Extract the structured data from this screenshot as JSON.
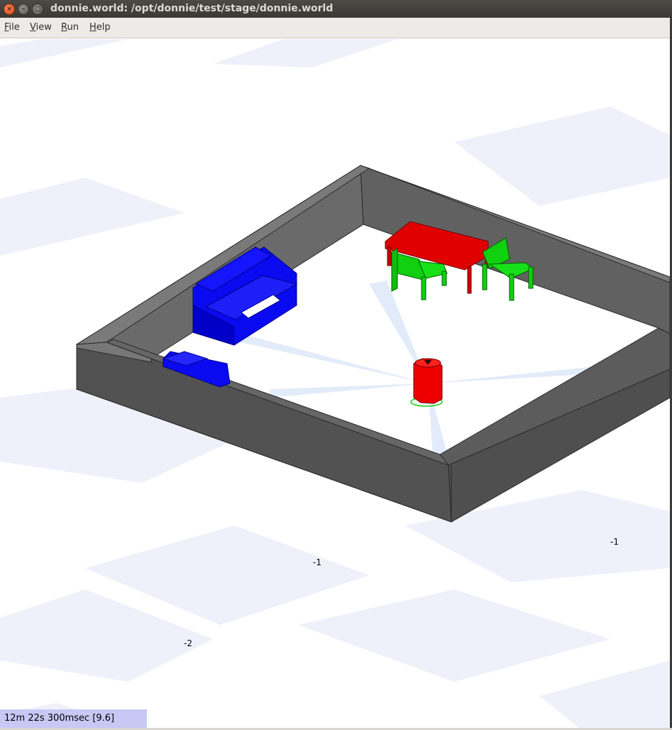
{
  "window": {
    "title": "donnie.world: /opt/donnie/test/stage/donnie.world",
    "close_icon": "×",
    "minimize_icon": "–",
    "maximize_icon": "□"
  },
  "menu": {
    "items": [
      {
        "mnemonic": "F",
        "rest": "ile"
      },
      {
        "mnemonic": "V",
        "rest": "iew"
      },
      {
        "mnemonic": "R",
        "rest": "un"
      },
      {
        "mnemonic": "H",
        "rest": "elp"
      }
    ]
  },
  "world": {
    "axis_labels": [
      "-1",
      "-1",
      "-2"
    ],
    "models": {
      "walls": {
        "color": "#4f4f4f"
      },
      "table": {
        "color": "#e00000"
      },
      "chairs": {
        "color": "#10d010"
      },
      "sofa": {
        "color": "#0a0af0"
      },
      "robot": {
        "color": "#ee0000"
      }
    },
    "floor_tint": "#f0f0fb"
  },
  "status": {
    "clock": "12m 22s 300msec [9.6]"
  }
}
